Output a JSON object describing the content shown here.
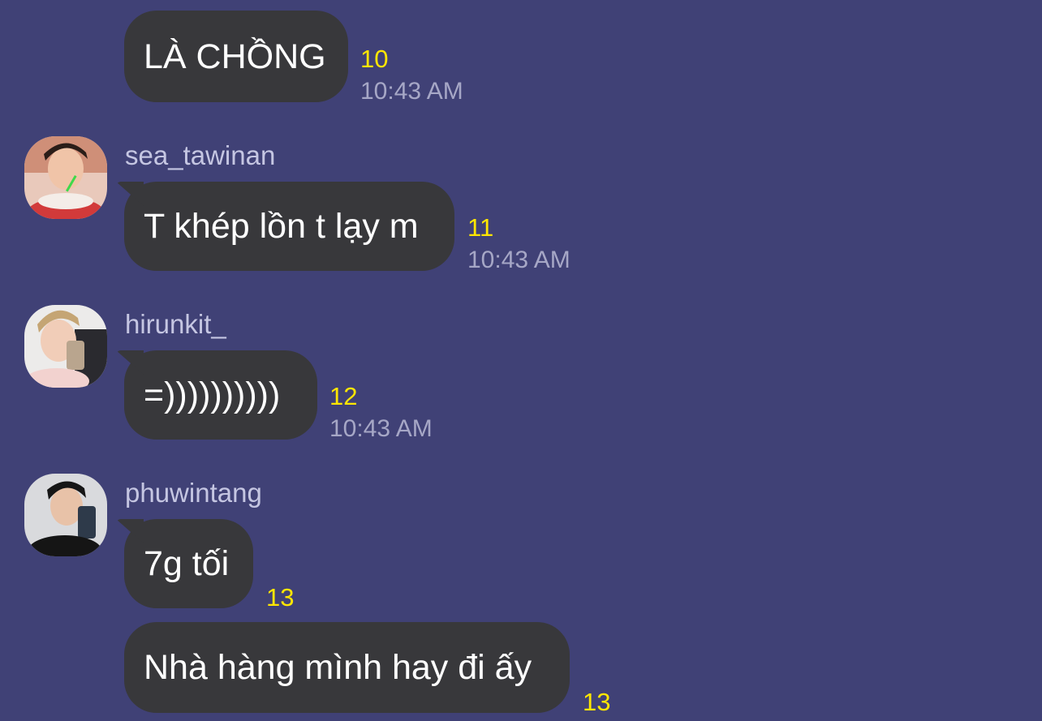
{
  "messages": [
    {
      "sender": "",
      "text": "LÀ CHỒNG",
      "read_count": "10",
      "time": "10:43 AM"
    },
    {
      "sender": "sea_tawinan",
      "text": "T khép lồn t lạy m",
      "read_count": "11",
      "time": "10:43 AM"
    },
    {
      "sender": "hirunkit_",
      "text": "=))))))))))",
      "read_count": "12",
      "time": "10:43 AM"
    },
    {
      "sender": "phuwintang",
      "text": "7g tối",
      "read_count": "13",
      "time": ""
    },
    {
      "sender": "",
      "text": "Nhà hàng mình hay đi ấy",
      "read_count": "13",
      "time": ""
    }
  ],
  "colors": {
    "background": "#404176",
    "bubble": "#38383b",
    "read_count": "#ffe600",
    "timestamp": "#a6a7c6",
    "username": "#c5c6e2"
  }
}
